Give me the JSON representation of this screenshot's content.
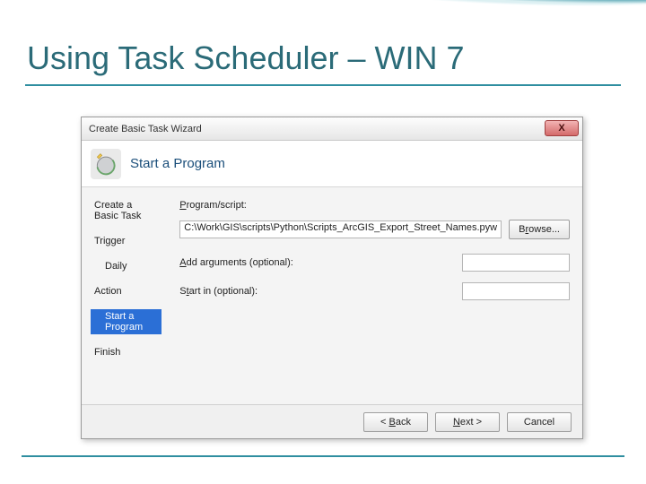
{
  "slide": {
    "title": "Using Task Scheduler – WIN 7"
  },
  "dialog": {
    "window_title": "Create Basic Task Wizard",
    "close_glyph": "X",
    "header_title": "Start a Program",
    "sidebar": {
      "items": [
        {
          "label": "Create a Basic Task",
          "sub": false,
          "selected": false
        },
        {
          "label": "Trigger",
          "sub": false,
          "selected": false
        },
        {
          "label": "Daily",
          "sub": true,
          "selected": false
        },
        {
          "label": "Action",
          "sub": false,
          "selected": false
        },
        {
          "label": "Start a Program",
          "sub": true,
          "selected": true
        },
        {
          "label": "Finish",
          "sub": false,
          "selected": false
        }
      ]
    },
    "form": {
      "program_label": "Program/script:",
      "program_value": "C:\\Work\\GIS\\scripts\\Python\\Scripts_ArcGIS_Export_Street_Names.pyw",
      "browse_label": "Browse...",
      "add_args_label": "Add arguments (optional):",
      "add_args_value": "",
      "start_in_label": "Start in (optional):",
      "start_in_value": ""
    },
    "footer": {
      "back_label": "< Back",
      "next_label": "Next >",
      "cancel_label": "Cancel"
    }
  }
}
